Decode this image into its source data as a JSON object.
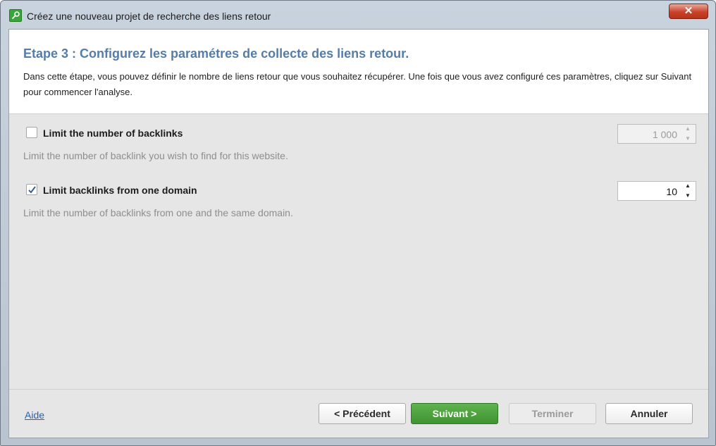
{
  "window": {
    "title": "Créez une nouveau projet de recherche des liens retour",
    "close_label": "✕"
  },
  "header": {
    "title": "Etape 3 : Configurez les paramétres de collecte des liens retour.",
    "description": "Dans cette étape, vous pouvez définir le nombre de liens retour que vous souhaitez récupérer. Une fois que vous avez configuré ces paramètres, cliquez sur Suivant pour commencer l'analyse."
  },
  "options": [
    {
      "label": "Limit the number of backlinks",
      "checked": false,
      "hint": "Limit the number of backlink you wish to find for this website.",
      "value": "1 000",
      "enabled": false
    },
    {
      "label": "Limit backlinks from one domain",
      "checked": true,
      "hint": "Limit the number of backlinks from one and the same domain.",
      "value": "10",
      "enabled": true
    }
  ],
  "footer": {
    "help_label": "Aide",
    "previous_label": "< Précédent",
    "next_label": "Suivant >",
    "finish_label": "Terminer",
    "cancel_label": "Annuler"
  },
  "spinner_glyphs": {
    "up": "▲",
    "down": "▼"
  },
  "colors": {
    "title_accent": "#557da8",
    "primary_button": "#4ea53e",
    "link": "#2c5fa8",
    "close_button": "#c9432a"
  }
}
